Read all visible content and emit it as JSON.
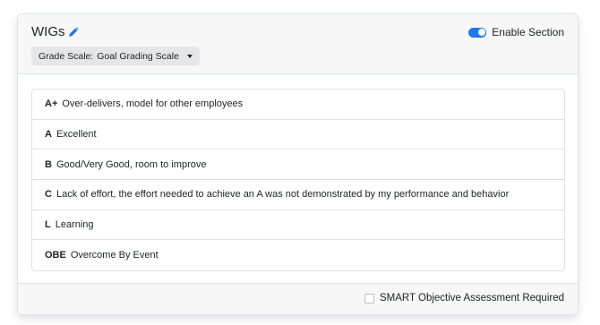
{
  "section": {
    "title": "WIGs",
    "edit_icon": "pencil-icon",
    "grade_scale_label": "Grade Scale:",
    "grade_scale_value": "Goal Grading Scale",
    "enable_section_label": "Enable Section",
    "enable_section_on": true,
    "accent_color": "#1f77e8"
  },
  "grading_scale": [
    {
      "grade": "A+",
      "description": "Over-delivers, model for other employees"
    },
    {
      "grade": "A",
      "description": "Excellent"
    },
    {
      "grade": "B",
      "description": "Good/Very Good, room to improve"
    },
    {
      "grade": "C",
      "description": "Lack of effort, the effort needed to achieve an A was not demonstrated by my performance and behavior"
    },
    {
      "grade": "L",
      "description": "Learning"
    },
    {
      "grade": "OBE",
      "description": "Overcome By Event"
    }
  ],
  "footer": {
    "smart_label": "SMART Objective Assessment Required",
    "smart_checked": false
  }
}
